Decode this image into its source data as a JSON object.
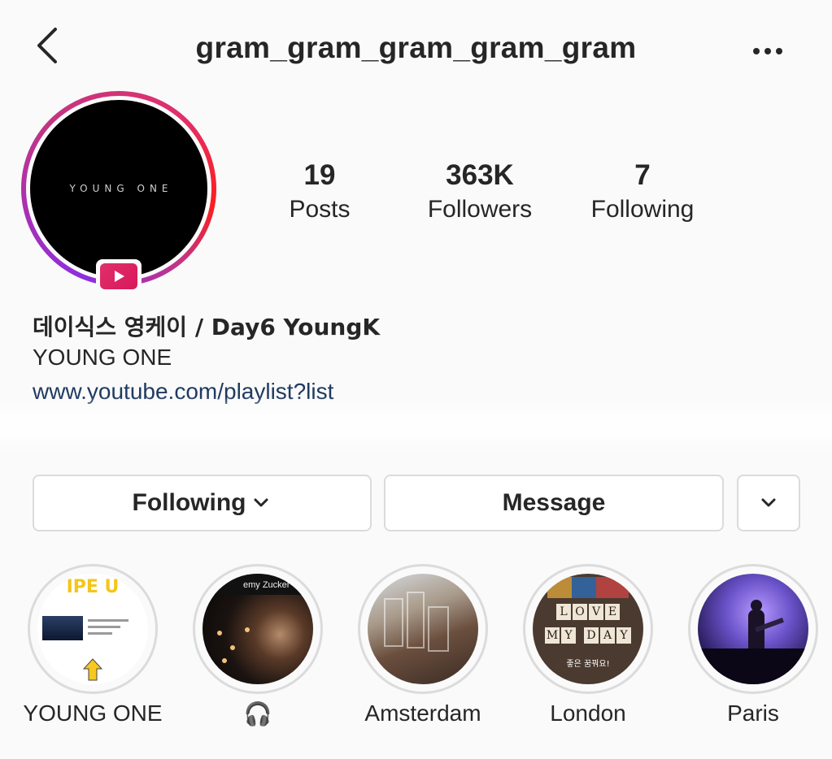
{
  "header": {
    "title": "gram_gram_gram_gram_gram",
    "back_icon": "chevron-left-icon",
    "more_icon": "ellipsis-icon"
  },
  "profile": {
    "avatar_text": "YOUNG ONE",
    "badge_icon": "igtv-play-icon",
    "ring_colors": [
      "#8e2de2",
      "#c13584",
      "#e1306c",
      "#fd1d1d"
    ],
    "stats": [
      {
        "value": "19",
        "label": "Posts"
      },
      {
        "value": "363K",
        "label": "Followers"
      },
      {
        "value": "7",
        "label": "Following"
      }
    ],
    "name": "데이식스 영케이 / Day6 YoungK",
    "bio": "YOUNG ONE",
    "link": "www.youtube.com/playlist?list"
  },
  "actions": {
    "following_label": "Following",
    "message_label": "Message"
  },
  "highlights": [
    {
      "label": "YOUNG ONE",
      "cover_text": "IPE U"
    },
    {
      "label": "🎧",
      "cover_text": "emy Zucker - Sc"
    },
    {
      "label": "Amsterdam"
    },
    {
      "label": "London",
      "cover_tiles_1": "LOVE",
      "cover_tiles_2": "MY DAY",
      "cover_text": "좋은 꿈꿔요!"
    },
    {
      "label": "Paris"
    }
  ]
}
